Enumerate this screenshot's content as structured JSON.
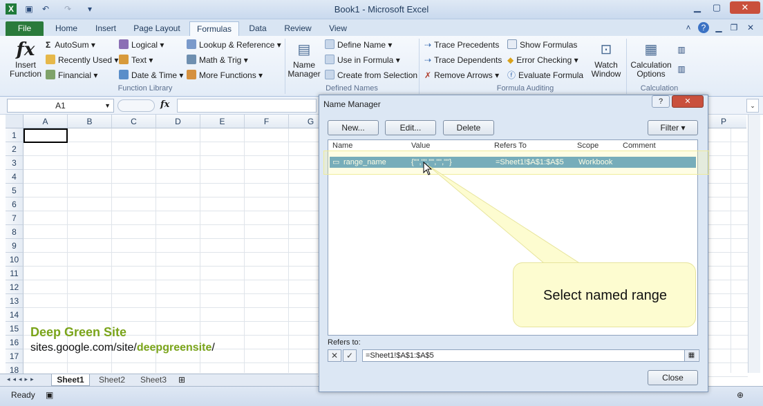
{
  "window": {
    "title": "Book1 - Microsoft Excel"
  },
  "tabs": [
    "File",
    "Home",
    "Insert",
    "Page Layout",
    "Formulas",
    "Data",
    "Review",
    "View"
  ],
  "ribbon": {
    "insert_function": "Insert Function",
    "autosum": "AutoSum",
    "recently_used": "Recently Used",
    "financial": "Financial",
    "logical": "Logical",
    "text": "Text",
    "date_time": "Date & Time",
    "lookup": "Lookup & Reference",
    "math": "Math & Trig",
    "more_functions": "More Functions",
    "function_library": "Function Library",
    "name_manager": "Name Manager",
    "define_name": "Define Name",
    "use_in_formula": "Use in Formula",
    "create_from_selection": "Create from Selection",
    "defined_names": "Defined Names",
    "trace_precedents": "Trace Precedents",
    "trace_dependents": "Trace Dependents",
    "remove_arrows": "Remove Arrows",
    "show_formulas": "Show Formulas",
    "error_checking": "Error Checking",
    "evaluate_formula": "Evaluate Formula",
    "watch_window": "Watch Window",
    "formula_auditing": "Formula Auditing",
    "calculation_options": "Calculation Options",
    "calculation": "Calculation"
  },
  "formula_bar": {
    "name_box": "A1",
    "fx": "fx"
  },
  "grid": {
    "columns": [
      "A",
      "B",
      "C",
      "D",
      "E",
      "F",
      "G"
    ],
    "rows": [
      "1",
      "2",
      "3",
      "4",
      "5",
      "6",
      "7",
      "8",
      "9",
      "10",
      "11",
      "12",
      "13",
      "14",
      "15",
      "16",
      "17",
      "18"
    ],
    "right_col": "P"
  },
  "overlay": {
    "site_name": "Deep Green Site",
    "site_url_prefix": "sites.google.com/site/",
    "site_url_highlight": "deepgreensite",
    "site_url_suffix": "/"
  },
  "sheets": [
    "Sheet1",
    "Sheet2",
    "Sheet3"
  ],
  "status": {
    "ready": "Ready"
  },
  "dialog": {
    "title": "Name Manager",
    "new": "New...",
    "edit": "Edit...",
    "delete": "Delete",
    "filter": "Filter",
    "headers": [
      "Name",
      "Value",
      "Refers To",
      "Scope",
      "Comment"
    ],
    "row": {
      "name": "range_name",
      "value": "{\"\",\"\",\"\",\"\",\"\"}",
      "refers_to": "=Sheet1!$A$1:$A$5",
      "scope": "Workbook",
      "comment": ""
    },
    "refers_to_label": "Refers to:",
    "refers_to_value": "=Sheet1!$A$1:$A$5",
    "close": "Close"
  },
  "callout": {
    "text": "Select named range"
  }
}
